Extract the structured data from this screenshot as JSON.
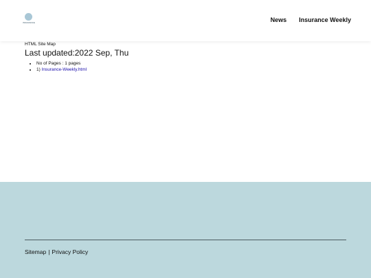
{
  "header": {
    "logo_text": "INSURANCE",
    "nav": [
      {
        "label": "News"
      },
      {
        "label": "Insurance Weekly"
      }
    ]
  },
  "main": {
    "sitemap_label": "HTML Site Map",
    "last_updated": "Last updated:2022 Sep, Thu",
    "pages_count": "No of Pages : 1 pages",
    "pages": [
      {
        "index": "1)",
        "link": "Insurance-Weekly.html"
      }
    ]
  },
  "footer": {
    "sitemap_label": "Sitemap",
    "separator": "|",
    "privacy_label": "Privacy Policy"
  },
  "colors": {
    "footer_bg": "#bcd8dd",
    "link": "#1a0dab",
    "logo": "#a9c7d6"
  }
}
